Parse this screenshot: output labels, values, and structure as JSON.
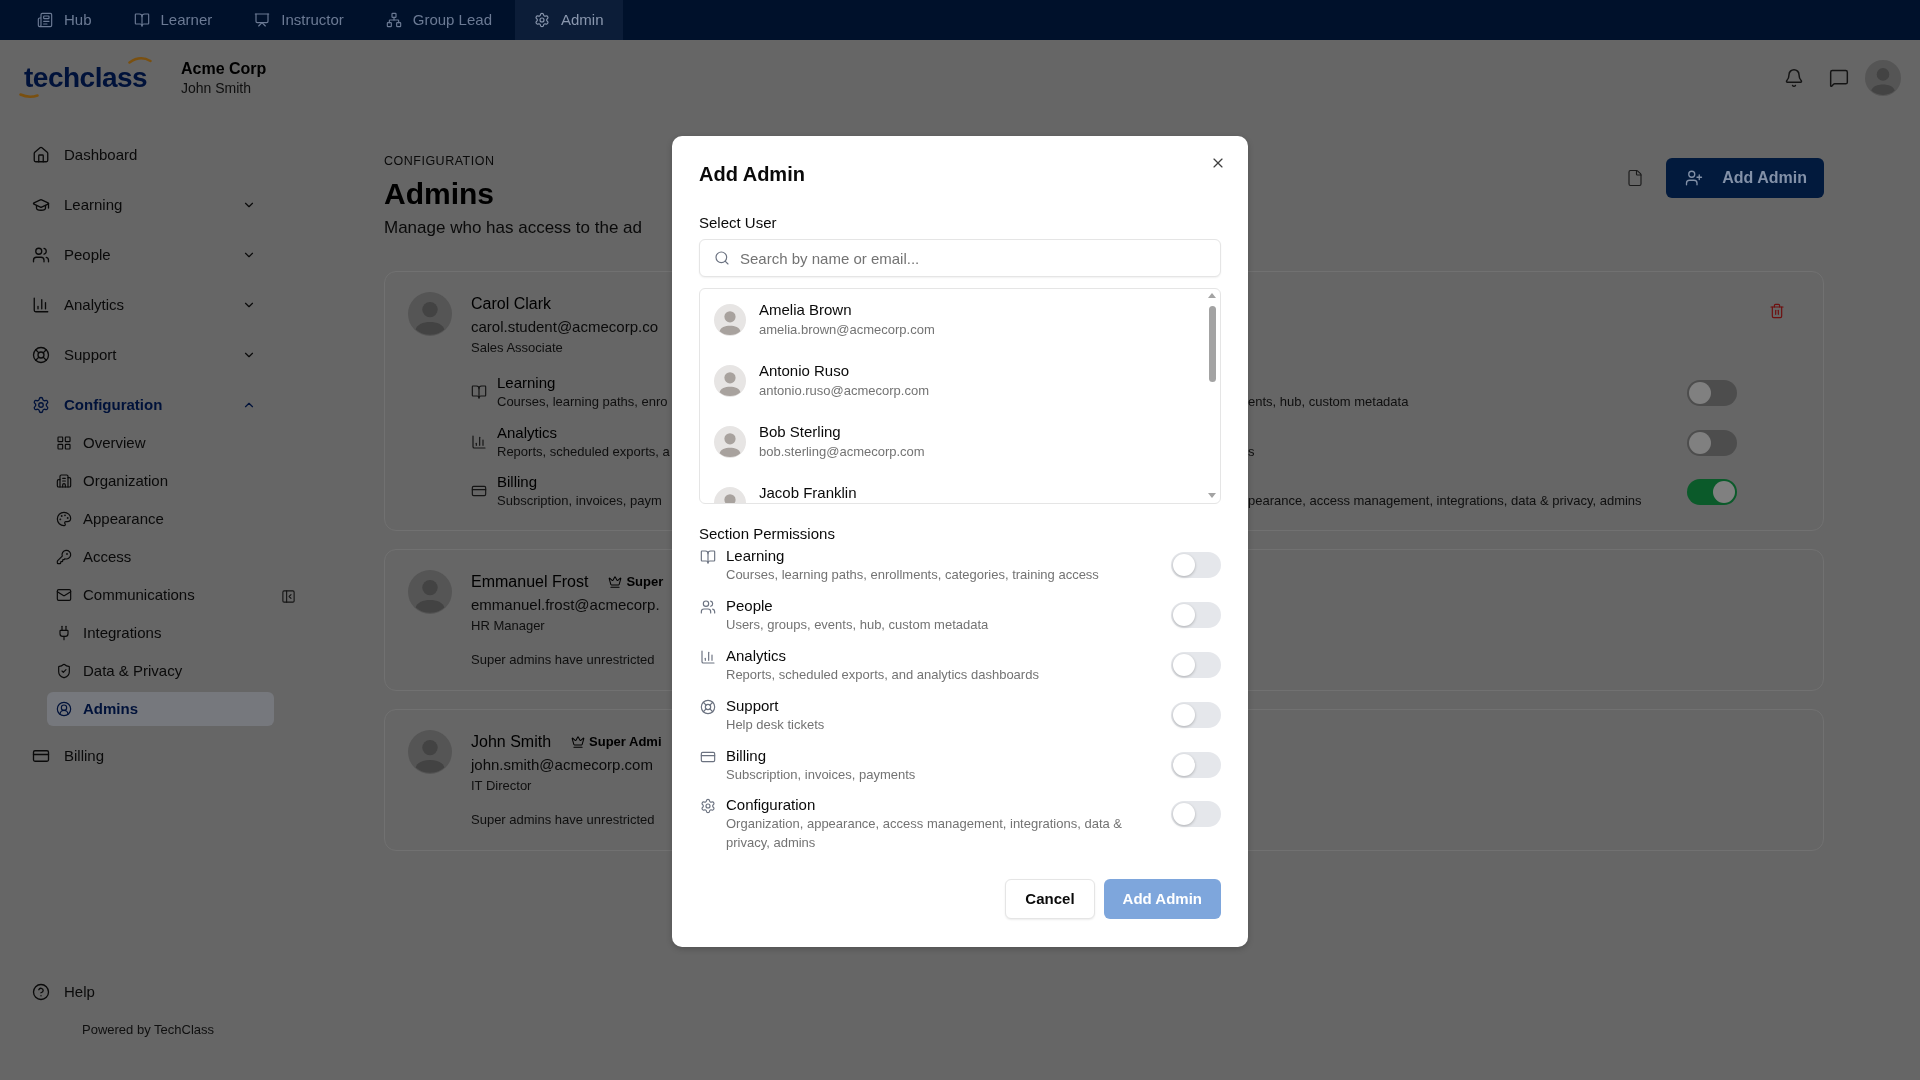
{
  "top_nav": {
    "tabs": [
      {
        "label": "Hub",
        "selected": false
      },
      {
        "label": "Learner",
        "selected": false
      },
      {
        "label": "Instructor",
        "selected": false
      },
      {
        "label": "Group Lead",
        "selected": false
      },
      {
        "label": "Admin",
        "selected": true
      }
    ]
  },
  "header": {
    "logo": "techclass",
    "organization": "Acme Corp",
    "user": "John Smith"
  },
  "sidebar": {
    "items": [
      {
        "kind": "link",
        "label": "Dashboard",
        "selected": false
      },
      {
        "kind": "group",
        "label": "Learning",
        "selected": false,
        "expanded": false
      },
      {
        "kind": "group",
        "label": "People",
        "selected": false,
        "expanded": false
      },
      {
        "kind": "group",
        "label": "Analytics",
        "selected": false,
        "expanded": false
      },
      {
        "kind": "group",
        "label": "Support",
        "selected": false,
        "expanded": false
      },
      {
        "kind": "group",
        "label": "Configuration",
        "selected": true,
        "expanded": true,
        "children": [
          {
            "label": "Overview",
            "selected": false
          },
          {
            "label": "Organization",
            "selected": false
          },
          {
            "label": "Appearance",
            "selected": false
          },
          {
            "label": "Access",
            "selected": false
          },
          {
            "label": "Communications",
            "selected": false
          },
          {
            "label": "Integrations",
            "selected": false
          },
          {
            "label": "Data & Privacy",
            "selected": false
          },
          {
            "label": "Admins",
            "selected": true
          }
        ]
      },
      {
        "kind": "link",
        "label": "Billing",
        "selected": false
      }
    ],
    "help": "Help",
    "footer": "Powered by TechClass"
  },
  "page": {
    "eyebrow": "CONFIGURATION",
    "title": "Admins",
    "description": "Manage who has access to the ad",
    "add_button": "Add Admin"
  },
  "admins": [
    {
      "kind": "custom",
      "name": "Carol Clark",
      "email": "carol.student@acmecorp.co",
      "role": "Sales Associate",
      "permissions": [
        {
          "kind": "learning",
          "title": "Learning",
          "description": "Courses, learning paths, enro"
        },
        {
          "kind": "analytics",
          "title": "Analytics",
          "description": "Reports, scheduled exports, a"
        },
        {
          "kind": "billing",
          "title": "Billing",
          "description": "Subscription, invoices, paym"
        }
      ],
      "permissions_right": [
        {
          "description": "ents, hub, custom metadata",
          "on": false
        },
        {
          "description": "s",
          "on": false
        },
        {
          "description": "pearance, access management, integrations, data & privacy, admins",
          "on": true
        }
      ]
    },
    {
      "kind": "super",
      "name": "Emmanuel Frost",
      "badge": "Super",
      "email": "emmanuel.frost@acmecorp.",
      "role": "HR Manager",
      "note": "Super admins have unrestricted"
    },
    {
      "kind": "super",
      "name": "John Smith",
      "badge": "Super Admi",
      "email": "john.smith@acmecorp.com",
      "role": "IT Director",
      "note": "Super admins have unrestricted"
    }
  ],
  "dialog": {
    "title": "Add Admin",
    "user_label": "Select User",
    "search": {
      "placeholder": "Search by name or email..."
    },
    "users": [
      {
        "name": "Amelia Brown",
        "email": "amelia.brown@acmecorp.com",
        "selected": false
      },
      {
        "name": "Antonio Ruso",
        "email": "antonio.ruso@acmecorp.com",
        "selected": false
      },
      {
        "name": "Bob Sterling",
        "email": "bob.sterling@acmecorp.com",
        "selected": false
      },
      {
        "name": "Jacob Franklin",
        "selected": false
      }
    ],
    "permissions_label": "Section Permissions",
    "sections": [
      {
        "kind": "learning",
        "title": "Learning",
        "description": "Courses, learning paths, enrollments, categories, training access",
        "on": false
      },
      {
        "kind": "people",
        "title": "People",
        "description": "Users, groups, events, hub, custom metadata",
        "on": false
      },
      {
        "kind": "analytics",
        "title": "Analytics",
        "description": "Reports, scheduled exports, and analytics dashboards",
        "on": false
      },
      {
        "kind": "support",
        "title": "Support",
        "description": "Help desk tickets",
        "on": false
      },
      {
        "kind": "billing",
        "title": "Billing",
        "description": "Subscription, invoices, payments",
        "on": false
      },
      {
        "kind": "configuration",
        "title": "Configuration",
        "description": "Organization, appearance, access management, integrations, data & privacy, admins",
        "on": false
      }
    ],
    "buttons": [
      {
        "kind": "secondary",
        "label": "Cancel",
        "disabled": false
      },
      {
        "kind": "primary",
        "label": "Add Admin",
        "disabled": true
      }
    ]
  }
}
